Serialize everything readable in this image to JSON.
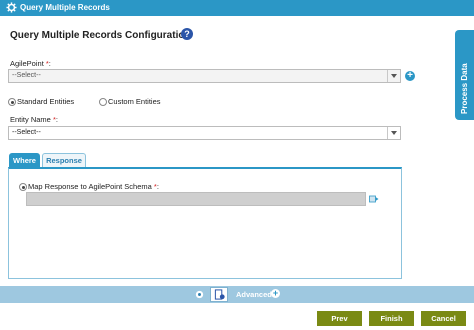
{
  "window": {
    "title": "Query Multiple Records"
  },
  "page": {
    "heading": "Query Multiple Records Configuration",
    "help_glyph": "?"
  },
  "agilepoint": {
    "label": "AgilePoint",
    "required": "*",
    "colon": ":",
    "value": "--Select--"
  },
  "entities": {
    "option_standard": "Standard Entities",
    "option_custom": "Custom Entities",
    "selected": "Standard Entities"
  },
  "entity_name": {
    "label": "Entity Name",
    "required": "*",
    "colon": ":",
    "value": "--Select--"
  },
  "tabs": [
    {
      "label": "Where",
      "active": true
    },
    {
      "label": "Response",
      "active": false
    }
  ],
  "response": {
    "map_label": "Map Response to AgilePoint Schema",
    "required": "*",
    "colon": ":"
  },
  "sidebar": {
    "process_data": "Process Data"
  },
  "bottom": {
    "advanced": "Advanced"
  },
  "buttons": {
    "prev": "Prev",
    "finish": "Finish",
    "cancel": "Cancel"
  },
  "colors": {
    "accent": "#2b97c6",
    "button": "#7a8a14",
    "toolbar": "#9ec8e0"
  },
  "icons": {
    "title": "gear-icon",
    "help": "help-icon",
    "add": "plus-icon",
    "advanced": "plus-icon"
  }
}
